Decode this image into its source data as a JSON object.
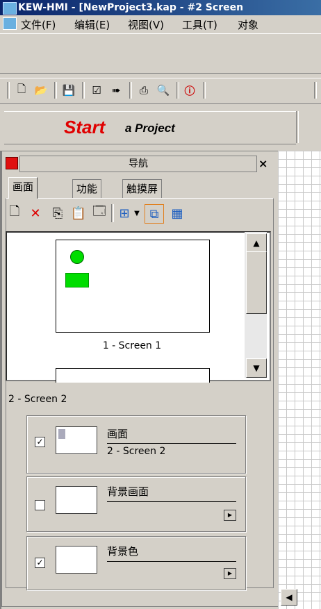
{
  "window": {
    "title": "KEW-HMI - [NewProject3.kap - #2 Screen"
  },
  "menu": {
    "items": [
      {
        "label": "文件(F)"
      },
      {
        "label": "编辑(E)"
      },
      {
        "label": "视图(V)"
      },
      {
        "label": "工具(T)"
      },
      {
        "label": "对象"
      }
    ]
  },
  "startbar": {
    "start": "Start",
    "rest": "a Project"
  },
  "navigation": {
    "title": "导航",
    "close": "×",
    "tabs": [
      {
        "label": "画面",
        "active": true
      },
      {
        "label": "功能",
        "active": false
      },
      {
        "label": "触摸屏",
        "active": false
      }
    ],
    "thumbnails": [
      {
        "label": "1 - Screen 1"
      }
    ],
    "current_screen": "2 - Screen 2",
    "groups": [
      {
        "title": "画面",
        "subtitle": "2 - Screen 2",
        "checked": true
      },
      {
        "title": "背景画面",
        "subtitle": "",
        "checked": false
      },
      {
        "title": "背景色",
        "subtitle": "",
        "checked": true
      }
    ]
  },
  "colors": {
    "accent_red": "#e00000",
    "screen_green": "#00dd00",
    "titlebar": "#0a246a"
  },
  "icons": [
    "new-file-icon",
    "open-folder-icon",
    "save-icon",
    "check-icon",
    "run-icon",
    "print-icon",
    "preview-icon",
    "info-icon"
  ]
}
